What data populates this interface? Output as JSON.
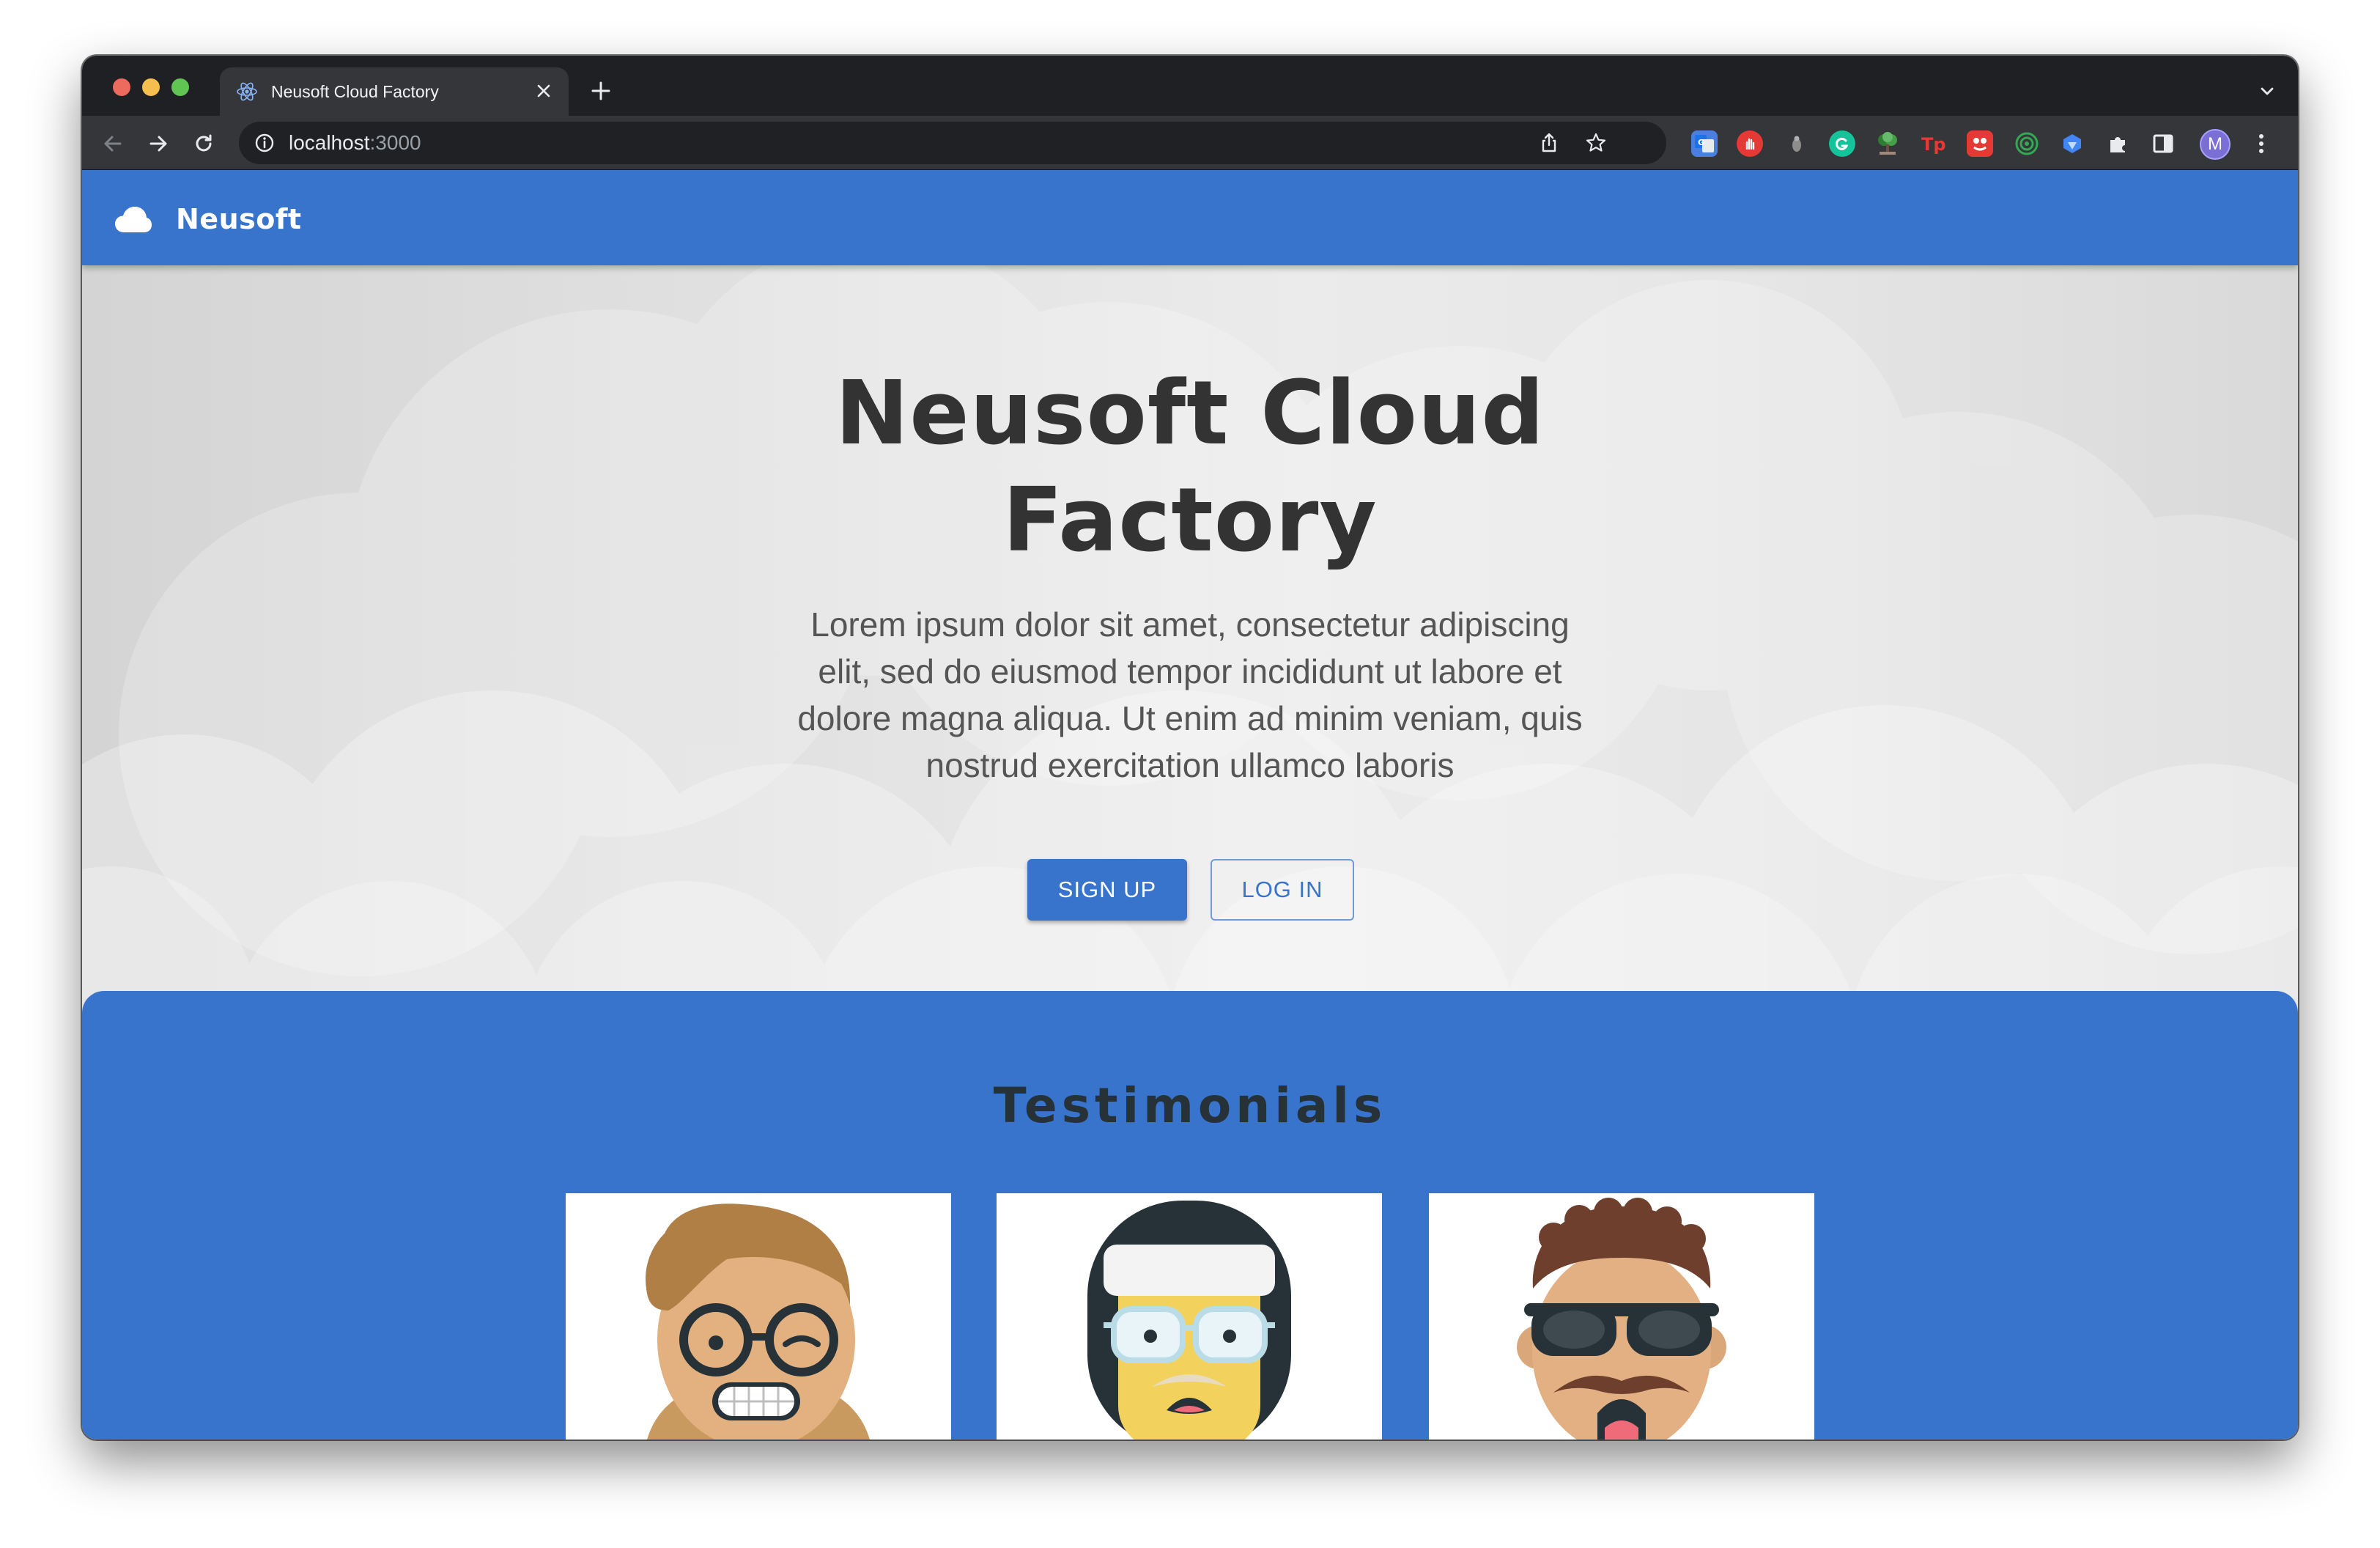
{
  "browser": {
    "tab_title": "Neusoft Cloud Factory",
    "url_host": "localhost",
    "url_port": ":3000",
    "avatar_letter": "M",
    "extensions": [
      "translate-icon",
      "adblock-icon",
      "dot-icon",
      "grammarly-icon",
      "tree-icon",
      "tp-icon",
      "red-ext-icon",
      "target-icon",
      "blue-ext-icon",
      "puzzle-icon",
      "sidebar-icon"
    ]
  },
  "app": {
    "brand": "Neusoft",
    "accent_color": "#3874cc"
  },
  "hero": {
    "title_line1": "Neusoft Cloud",
    "title_line2": "Factory",
    "description": "Lorem ipsum dolor sit amet, consectetur adipiscing elit, sed do eiusmod tempor incididunt ut labore et dolore magna aliqua. Ut enim ad minim veniam, quis nostrud exercitation ullamco laboris",
    "signup_label": "SIGN UP",
    "login_label": "LOG IN"
  },
  "testimonials": {
    "heading": "Testimonials",
    "avatars": [
      "winking-glasses-avatar",
      "headband-glasses-avatar",
      "sunglasses-mustache-avatar"
    ]
  }
}
